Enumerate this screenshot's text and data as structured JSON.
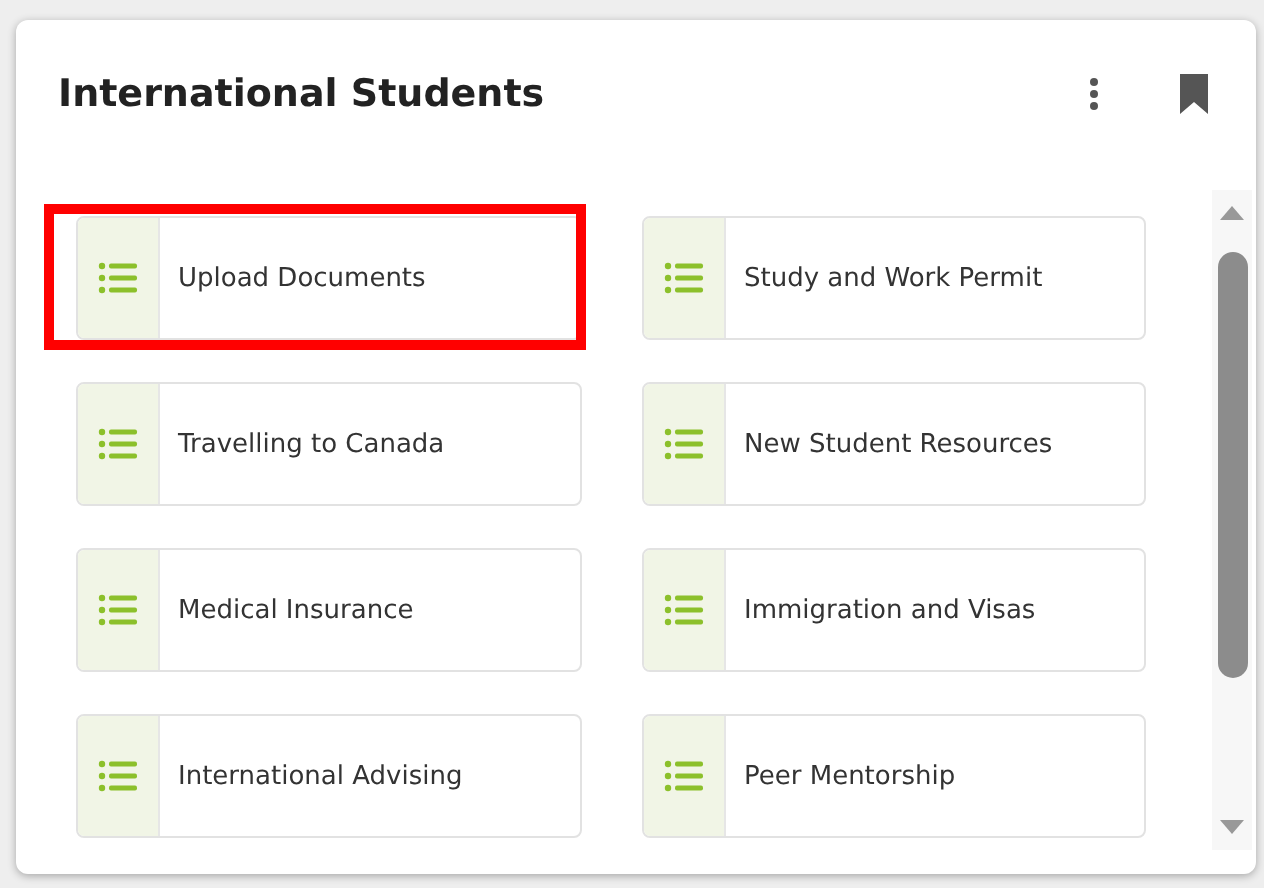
{
  "card": {
    "title": "International Students"
  },
  "tiles": [
    {
      "label": "Upload Documents",
      "highlighted": true
    },
    {
      "label": "Study and Work Permit",
      "highlighted": false
    },
    {
      "label": "Travelling to Canada",
      "highlighted": false
    },
    {
      "label": "New Student Resources",
      "highlighted": false
    },
    {
      "label": "Medical Insurance",
      "highlighted": false
    },
    {
      "label": "Immigration and Visas",
      "highlighted": false
    },
    {
      "label": "International Advising",
      "highlighted": false
    },
    {
      "label": "Peer Mentorship",
      "highlighted": false
    }
  ]
}
